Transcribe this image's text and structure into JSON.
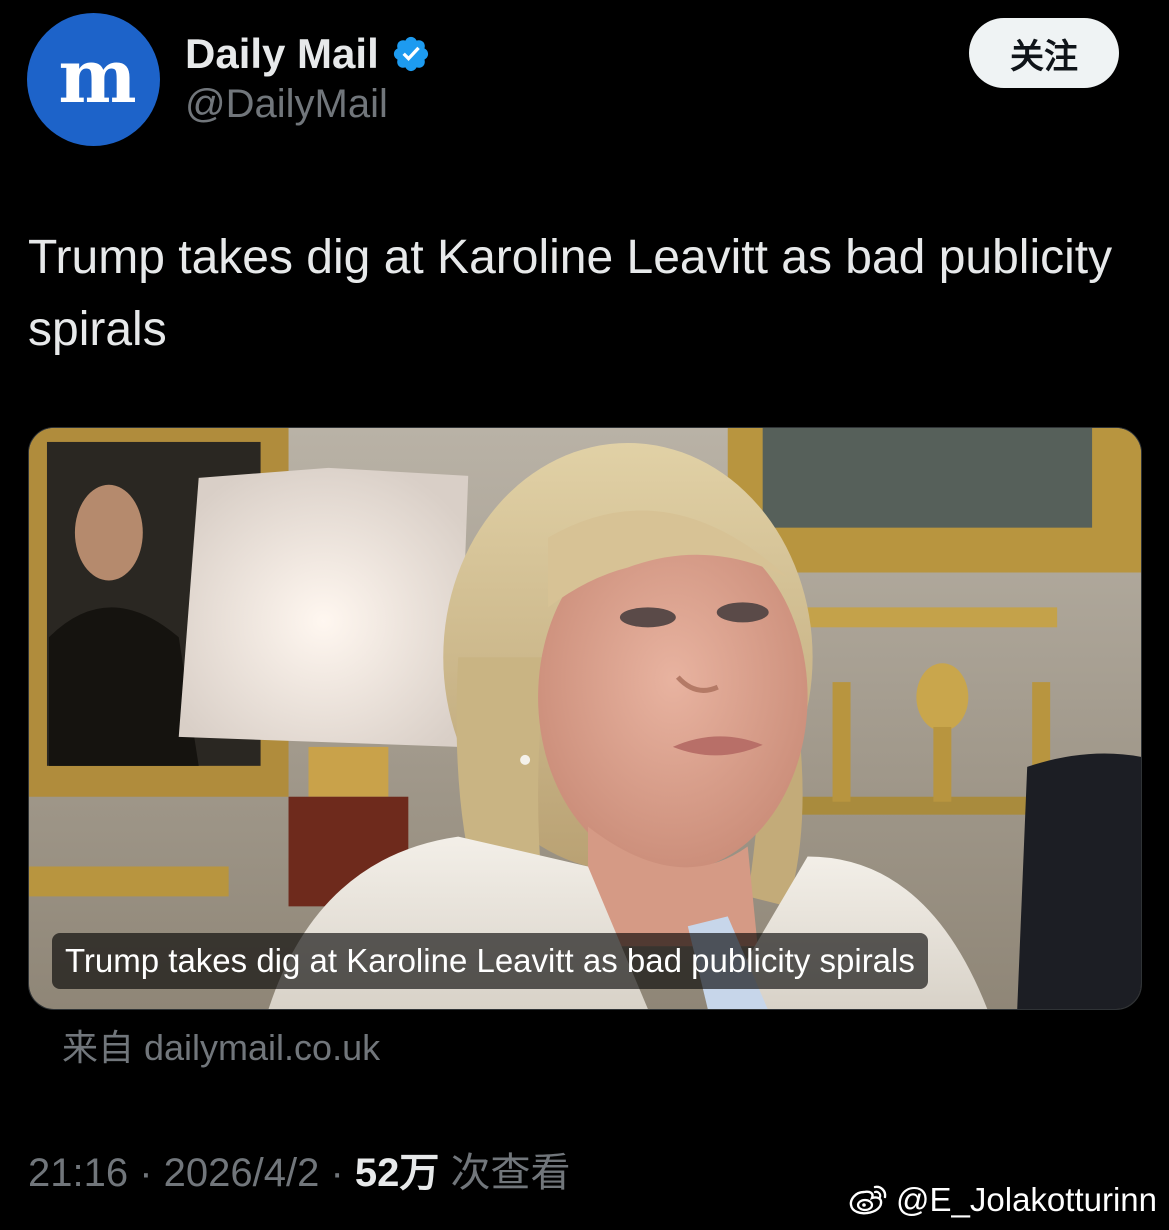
{
  "account": {
    "display_name": "Daily Mail",
    "handle": "@DailyMail",
    "avatar_glyph": "m",
    "avatar_color": "#1d63c9",
    "verified": true,
    "verified_icon": "verified-badge-icon",
    "verified_color": "#1d9bf0"
  },
  "follow_button": {
    "label": "关注"
  },
  "tweet": {
    "text": "Trump takes dig at Karoline Leavitt as bad publicity spirals"
  },
  "link_card": {
    "caption": "Trump takes dig at Karoline Leavitt as bad publicity spirals",
    "source": "来自 dailymail.co.uk"
  },
  "meta": {
    "time": "21:16",
    "separator": " · ",
    "date": "2026/4/2",
    "views_count": "52万",
    "views_label": " 次查看"
  },
  "watermark": {
    "icon": "weibo-icon",
    "text": "@E_Jolakotturinn"
  }
}
